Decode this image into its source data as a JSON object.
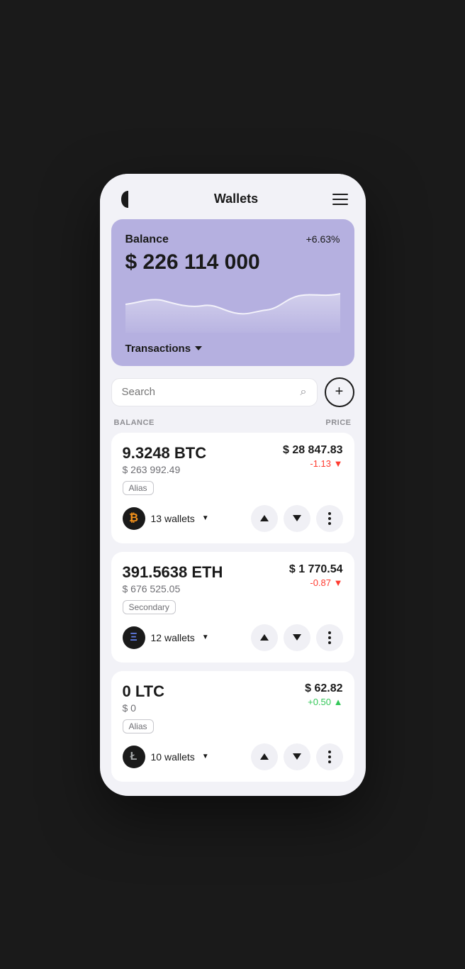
{
  "app": {
    "title": "Wallets"
  },
  "header": {
    "title": "Wallets",
    "menu_label": "Menu"
  },
  "balance_card": {
    "label": "Balance",
    "percent": "+6.63%",
    "amount": "$ 226 114 000",
    "transactions_label": "Transactions"
  },
  "search": {
    "placeholder": "Search",
    "add_label": "+"
  },
  "columns": {
    "balance": "BALANCE",
    "price": "PRICE"
  },
  "cryptos": [
    {
      "amount": "9.3248 BTC",
      "usd": "$ 263 992.49",
      "alias": "Alias",
      "price": "$ 28 847.83",
      "change": "-1.13",
      "change_type": "negative",
      "wallets": "13 wallets",
      "symbol": "₿",
      "icon_class": "btc-icon"
    },
    {
      "amount": "391.5638 ETH",
      "usd": "$ 676 525.05",
      "alias": "Secondary",
      "price": "$ 1 770.54",
      "change": "-0.87",
      "change_type": "negative",
      "wallets": "12 wallets",
      "symbol": "Ξ",
      "icon_class": "eth-icon"
    },
    {
      "amount": "0 LTC",
      "usd": "$ 0",
      "alias": "Alias",
      "price": "$ 62.82",
      "change": "+0.50",
      "change_type": "positive",
      "wallets": "10 wallets",
      "symbol": "Ł",
      "icon_class": "ltc-icon"
    }
  ]
}
